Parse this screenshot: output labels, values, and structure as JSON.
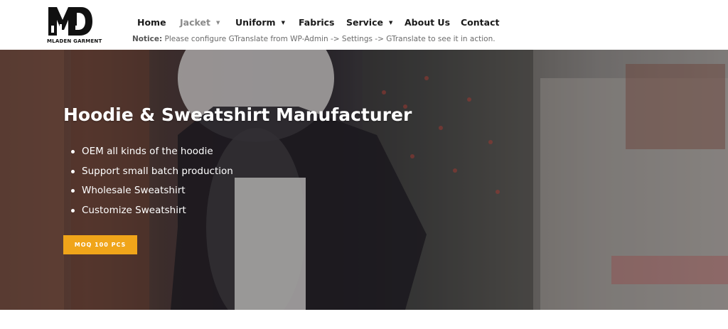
{
  "brand": {
    "logo_text": "MLADEN GARMENT",
    "logo_icon": "md-monogram-icon"
  },
  "nav": {
    "items": [
      {
        "label": "Home",
        "dropdown": false,
        "active": false
      },
      {
        "label": "Jacket",
        "dropdown": true,
        "active": true
      },
      {
        "label": "Uniform",
        "dropdown": true,
        "active": false
      },
      {
        "label": "Fabrics",
        "dropdown": false,
        "active": false
      },
      {
        "label": "Service",
        "dropdown": true,
        "active": false
      },
      {
        "label": "About Us",
        "dropdown": false,
        "active": false
      },
      {
        "label": "Contact",
        "dropdown": false,
        "active": false
      }
    ],
    "caret_icon": "▼"
  },
  "notice": {
    "label": "Notice:",
    "text": " Please configure GTranslate from WP-Admin -> Settings -> GTranslate to see it in action."
  },
  "hero": {
    "title": "Hoodie & Sweatshirt Manufacturer",
    "bullets": [
      "OEM all kinds of the hoodie",
      "Support small batch production",
      "Wholesale Sweatshirt",
      "Customize Sweatshirt"
    ],
    "cta_label": "MOQ 100 PCS"
  },
  "colors": {
    "accent": "#f0a51a",
    "text_dark": "#1a1a1a",
    "active_nav": "#8a8a8a"
  }
}
